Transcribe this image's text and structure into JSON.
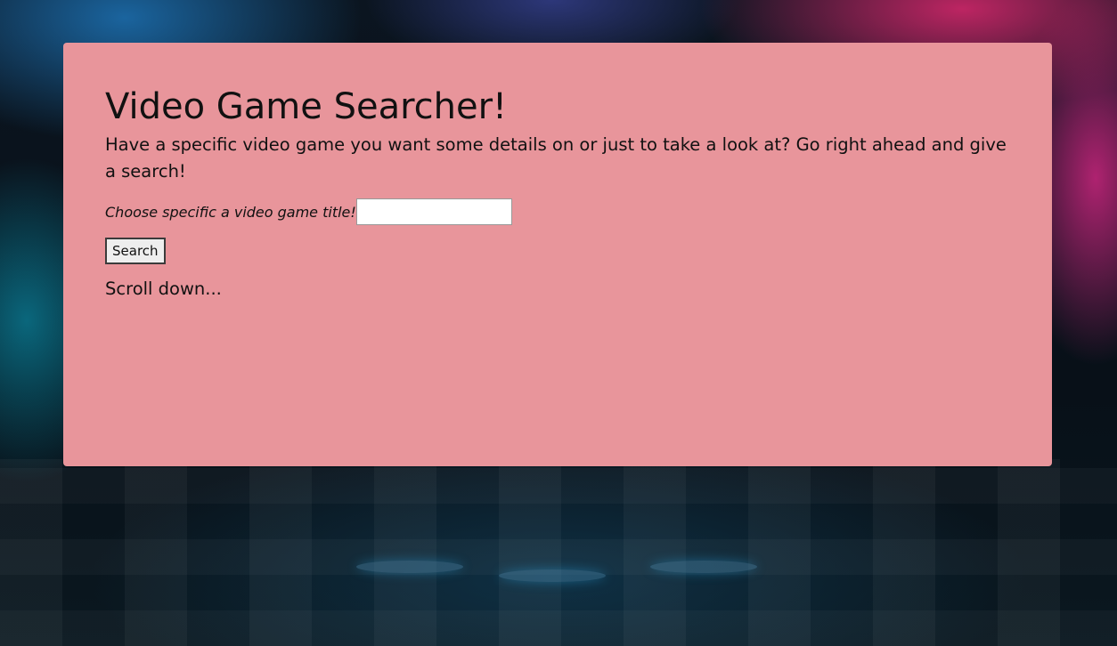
{
  "header": {
    "title": "Video Game Searcher!",
    "description": "Have a specific video game you want some details on or just to take a look at? Go right ahead and give a search!"
  },
  "search": {
    "label": "Choose specific a video game title!",
    "value": "",
    "placeholder": "",
    "button_label": "Search"
  },
  "footer": {
    "note": "Scroll down..."
  },
  "colors": {
    "panel": "#e8959b",
    "text": "#111111"
  }
}
